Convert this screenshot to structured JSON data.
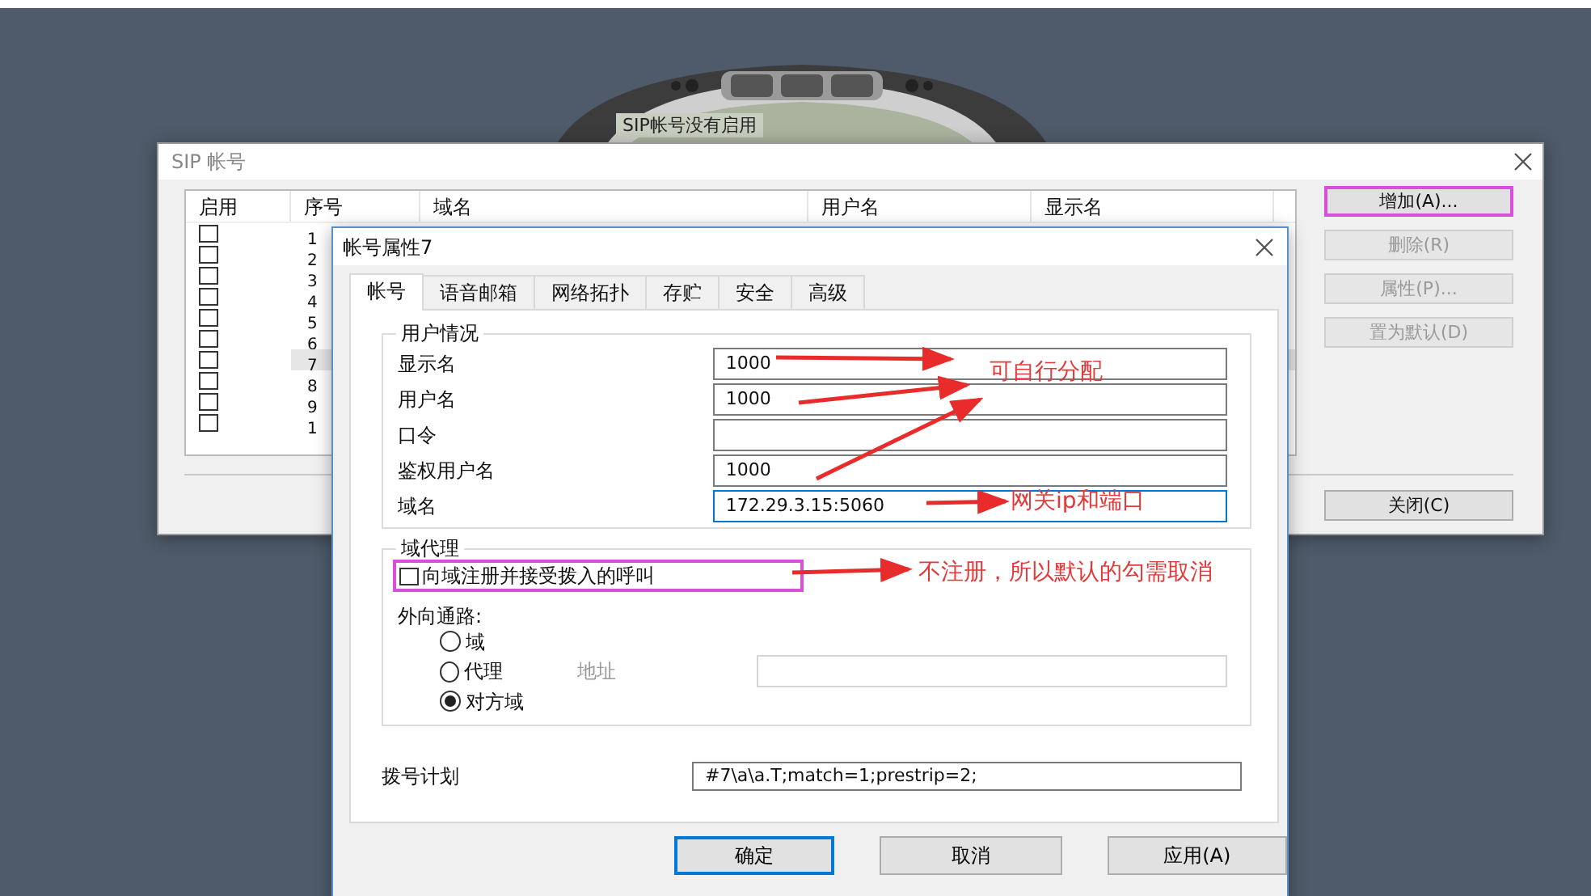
{
  "phone": {
    "display": "SIP帐号没有启用"
  },
  "accounts_window": {
    "title": "SIP 帐号",
    "columns": [
      "启用",
      "序号",
      "域名",
      "用户名",
      "显示名"
    ],
    "rows": [
      {
        "enabled": false,
        "number": "1",
        "selected": false
      },
      {
        "enabled": false,
        "number": "2",
        "selected": false
      },
      {
        "enabled": false,
        "number": "3",
        "selected": false
      },
      {
        "enabled": false,
        "number": "4",
        "selected": false
      },
      {
        "enabled": false,
        "number": "5",
        "selected": false
      },
      {
        "enabled": false,
        "number": "6",
        "selected": false
      },
      {
        "enabled": false,
        "number": "7",
        "selected": true
      },
      {
        "enabled": false,
        "number": "8",
        "selected": false
      },
      {
        "enabled": false,
        "number": "9",
        "selected": false
      },
      {
        "enabled": false,
        "number": "1",
        "selected": false
      }
    ],
    "buttons": [
      {
        "label": "增加(A)...",
        "disabled": false,
        "highlighted": true
      },
      {
        "label": "删除(R)",
        "disabled": true,
        "highlighted": false
      },
      {
        "label": "属性(P)...",
        "disabled": true,
        "highlighted": false
      },
      {
        "label": "置为默认(D)",
        "disabled": true,
        "highlighted": false
      }
    ],
    "close_button": "关闭(C)"
  },
  "dialog": {
    "title": "帐号属性7",
    "tabs": [
      {
        "label": "帐号",
        "selected": true
      },
      {
        "label": "语音邮箱",
        "selected": false
      },
      {
        "label": "网络拓扑",
        "selected": false
      },
      {
        "label": "存贮",
        "selected": false
      },
      {
        "label": "安全",
        "selected": false
      },
      {
        "label": "高级",
        "selected": false
      }
    ],
    "user_group": {
      "title": "用户情况",
      "fields": [
        {
          "label": "显示名",
          "value": "1000",
          "focused": false
        },
        {
          "label": "用户名",
          "value": "1000",
          "focused": false
        },
        {
          "label": "口令",
          "focused": false
        },
        {
          "label": "鉴权用户名",
          "value": "1000",
          "focused": false
        },
        {
          "label": "域名",
          "value": "172.29.3.15:5060",
          "focused": true
        }
      ]
    },
    "proxy_group": {
      "title": "域代理",
      "register": {
        "label": "向域注册并接受拨入的呼叫",
        "checked": false,
        "highlighted": true
      },
      "outbound_label": "外向通路:",
      "routes": [
        {
          "label": "域",
          "selected": false
        },
        {
          "label": "代理",
          "selected": false
        },
        {
          "label": "对方域",
          "selected": true
        }
      ],
      "address": {
        "label": "地址",
        "disabled": true
      }
    },
    "dial_plan": {
      "label": "拨号计划",
      "value": "#7\\a\\a.T;match=1;prestrip=2;"
    },
    "buttons": [
      {
        "label": "确定",
        "default": true
      },
      {
        "label": "取消",
        "default": false
      },
      {
        "label": "应用(A)",
        "default": false
      }
    ]
  },
  "annotations": [
    "可自行分配",
    "网关ip和端口",
    "不注册，所以默认的勾需取消"
  ]
}
